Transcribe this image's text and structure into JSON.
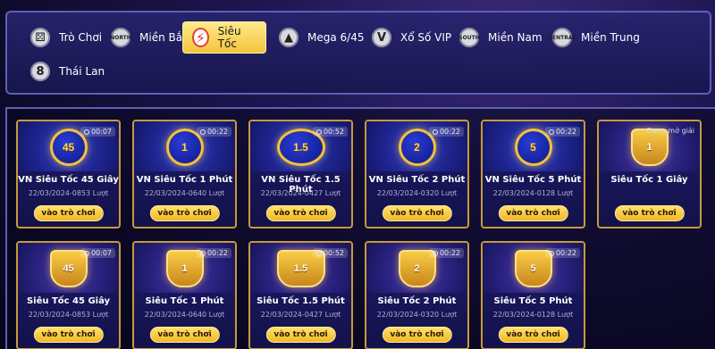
{
  "categories": [
    {
      "label": "Trò Chơi",
      "icon": "dice-icon",
      "glyph": "⚄",
      "active": false
    },
    {
      "label": "Miền Bắc",
      "icon": "north-region-icon",
      "glyph": "NORTH",
      "active": false
    },
    {
      "label": "Siêu Tốc",
      "icon": "lightning-icon",
      "glyph": "⚡",
      "active": true
    },
    {
      "label": "Mega 6/45",
      "icon": "mega-icon",
      "glyph": "▲",
      "active": false
    },
    {
      "label": "Xổ Số VIP",
      "icon": "vip-icon",
      "glyph": "V",
      "active": false
    },
    {
      "label": "Miền Nam",
      "icon": "south-region-icon",
      "glyph": "SOUTH",
      "active": false
    },
    {
      "label": "Miền Trung",
      "icon": "central-region-icon",
      "glyph": "CENTRAL",
      "active": false
    },
    {
      "label": "Thái Lan",
      "icon": "thailand-lottery-icon",
      "glyph": "8",
      "active": false
    }
  ],
  "games": [
    {
      "emblem": "45",
      "title": "VN Siêu Tốc 45 Giây",
      "date": "22/03/2024-0853 Lượt",
      "timer": "00:07",
      "status": "",
      "button": "vào trò chơi",
      "style": "ball"
    },
    {
      "emblem": "1",
      "title": "VN Siêu Tốc 1 Phút",
      "date": "22/03/2024-0640 Lượt",
      "timer": "00:22",
      "status": "",
      "button": "vào trò chơi",
      "style": "ball"
    },
    {
      "emblem": "1.5",
      "title": "VN Siêu Tốc 1.5 Phút",
      "date": "22/03/2024-0427 Lượt",
      "timer": "00:52",
      "status": "",
      "button": "vào trò chơi",
      "style": "ball"
    },
    {
      "emblem": "2",
      "title": "VN Siêu Tốc 2 Phút",
      "date": "22/03/2024-0320 Lượt",
      "timer": "00:22",
      "status": "",
      "button": "vào trò chơi",
      "style": "ball"
    },
    {
      "emblem": "5",
      "title": "VN Siêu Tốc 5 Phút",
      "date": "22/03/2024-0128 Lượt",
      "timer": "00:22",
      "status": "",
      "button": "vào trò chơi",
      "style": "ball"
    },
    {
      "emblem": "1",
      "title": "Siêu Tốc 1 Giây",
      "date": "",
      "timer": "",
      "status": "Đang mở giải",
      "button": "vào trò chơi",
      "style": "trophy"
    },
    {
      "emblem": "45",
      "title": "Siêu Tốc 45 Giây",
      "date": "22/03/2024-0853 Lượt",
      "timer": "00:07",
      "status": "",
      "button": "vào trò chơi",
      "style": "trophy"
    },
    {
      "emblem": "1",
      "title": "Siêu Tốc 1 Phút",
      "date": "22/03/2024-0640 Lượt",
      "timer": "00:22",
      "status": "",
      "button": "vào trò chơi",
      "style": "trophy"
    },
    {
      "emblem": "1.5",
      "title": "Siêu Tốc 1.5 Phút",
      "date": "22/03/2024-0427 Lượt",
      "timer": "00:52",
      "status": "",
      "button": "vào trò chơi",
      "style": "trophy"
    },
    {
      "emblem": "2",
      "title": "Siêu Tốc 2 Phút",
      "date": "22/03/2024-0320 Lượt",
      "timer": "00:22",
      "status": "",
      "button": "vào trò chơi",
      "style": "trophy"
    },
    {
      "emblem": "5",
      "title": "Siêu Tốc 5 Phút",
      "date": "22/03/2024-0128 Lượt",
      "timer": "00:22",
      "status": "",
      "button": "vào trò chơi",
      "style": "trophy"
    }
  ],
  "colors": {
    "accent": "#f3c43d",
    "card_border": "#c79a3a",
    "frame": "#5f5fb6"
  }
}
